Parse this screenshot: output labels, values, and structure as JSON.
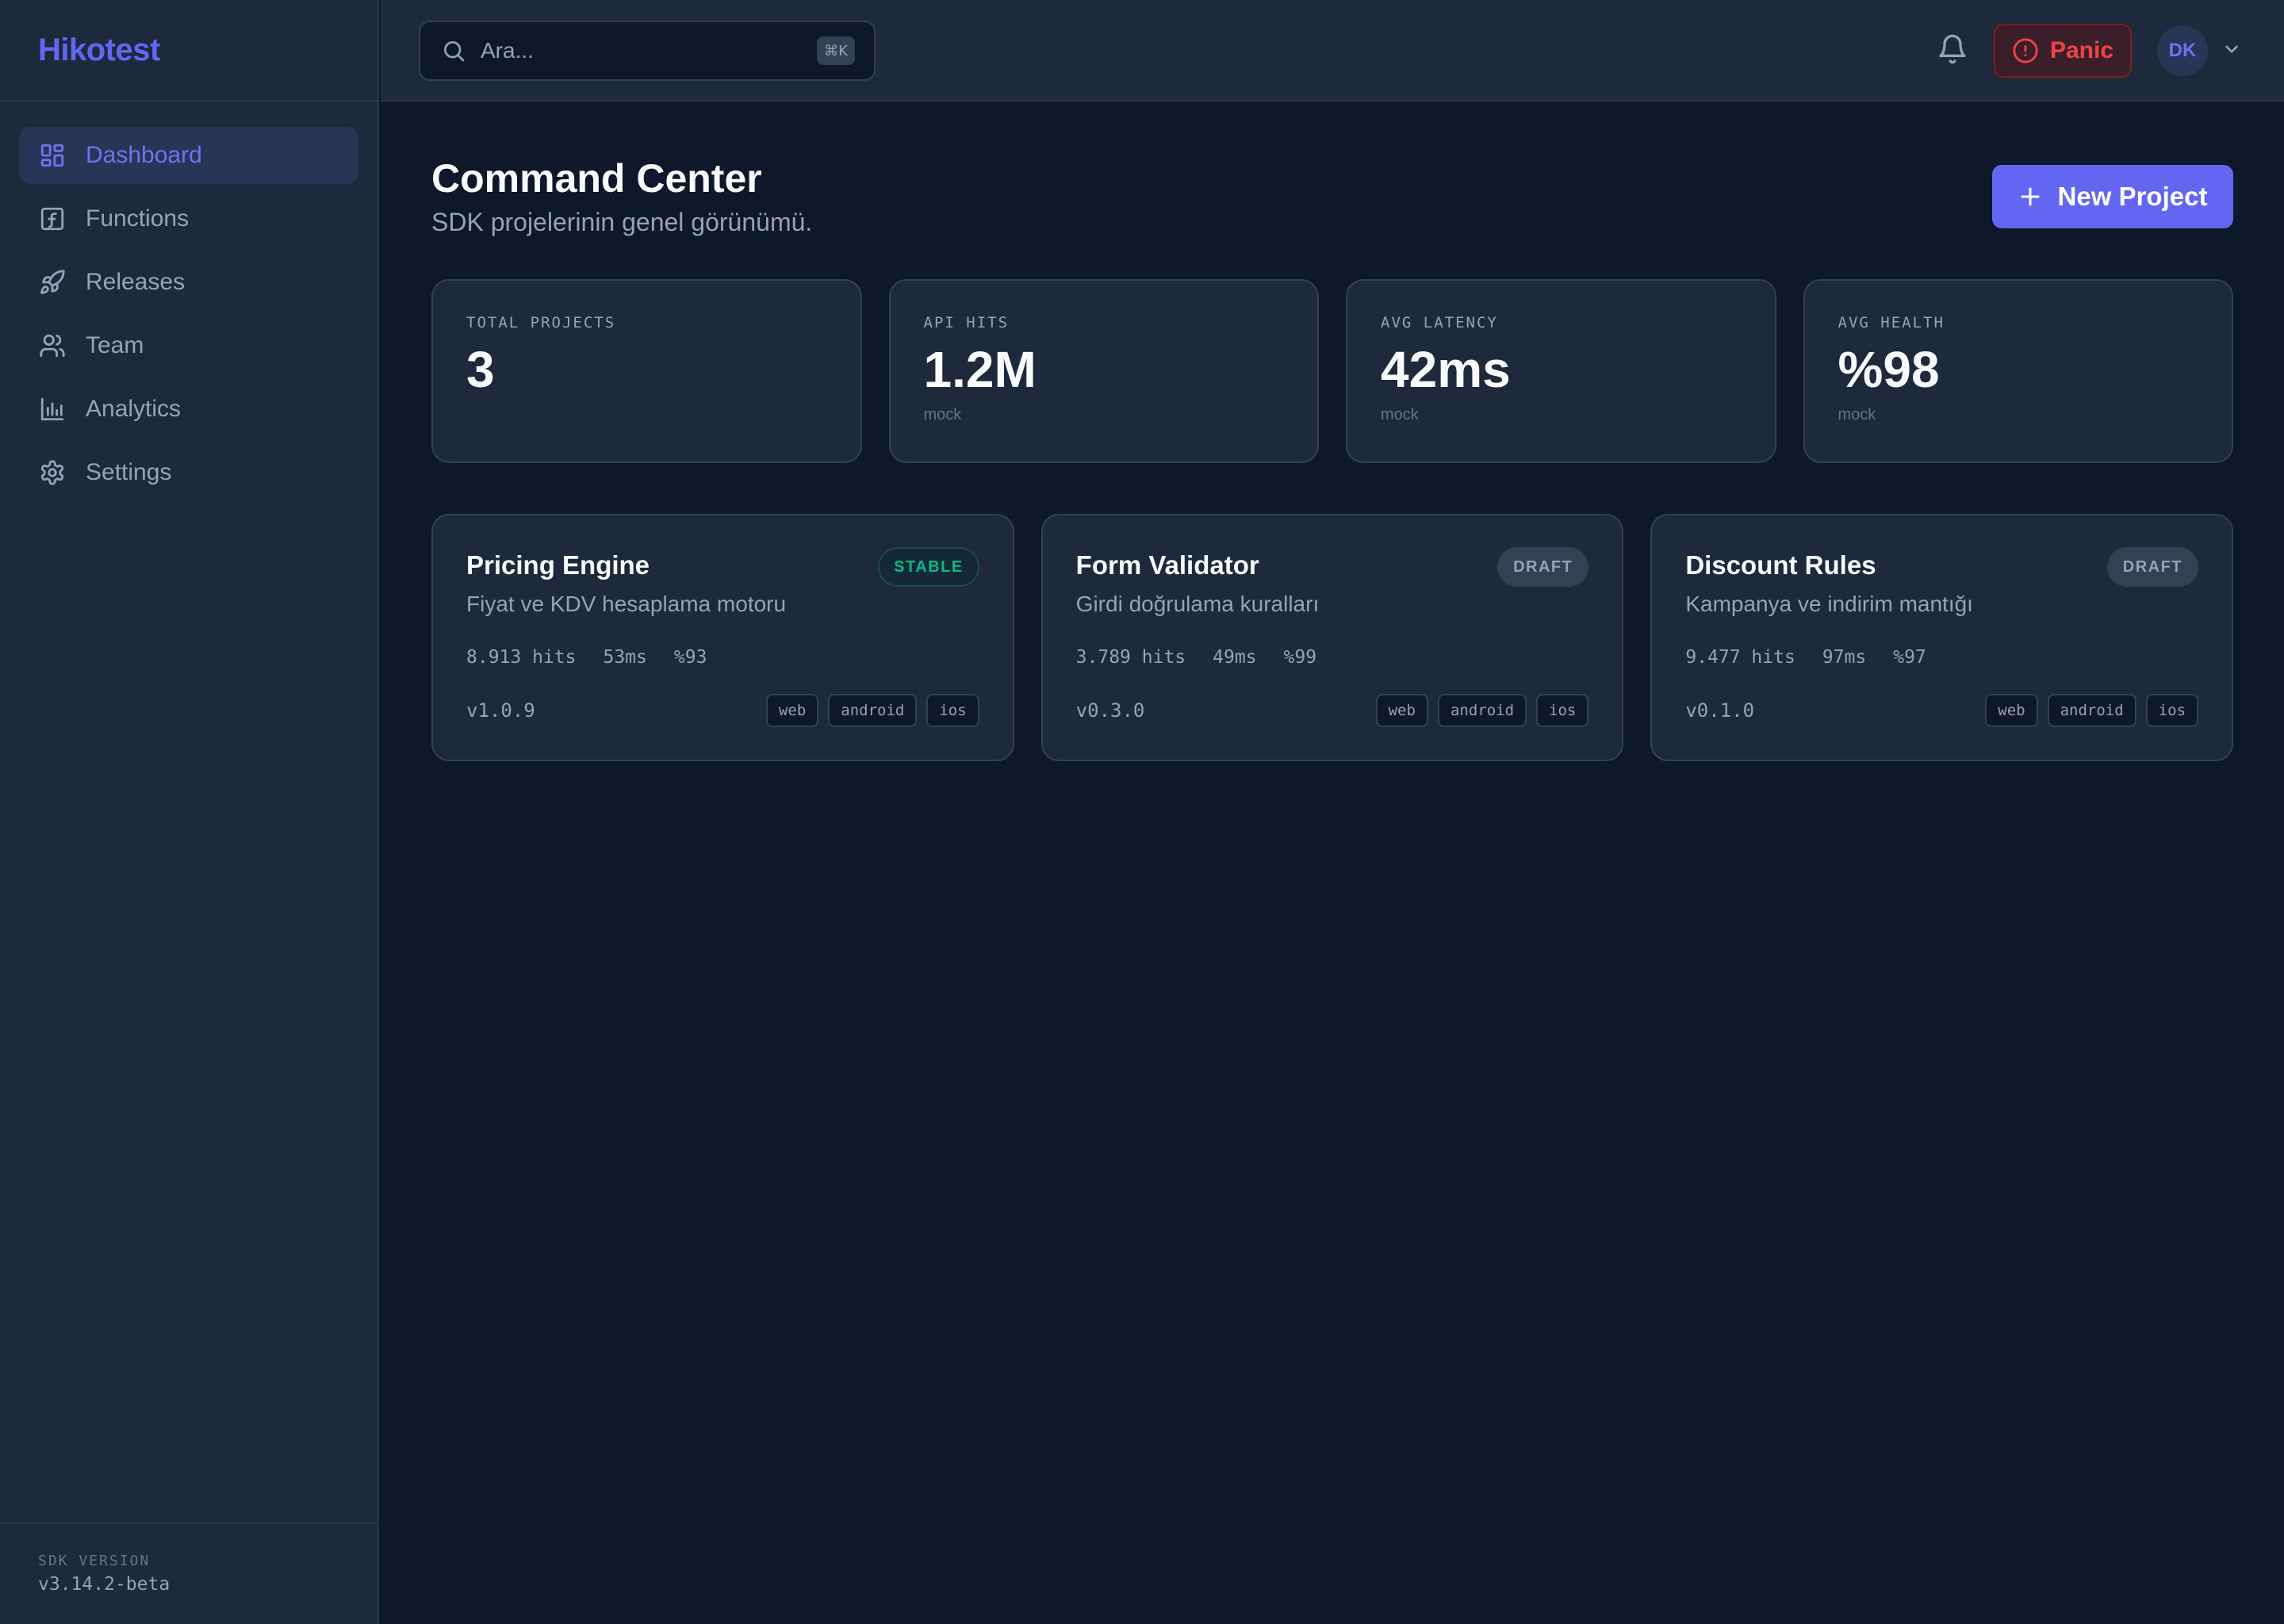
{
  "app": {
    "name": "Hikotest"
  },
  "theme": {
    "accent": "#6366f1",
    "background": "#0f172a",
    "panel": "#1e293b",
    "danger": "#ef4444",
    "success": "#10b981"
  },
  "sidebar": {
    "items": [
      {
        "label": "Dashboard",
        "icon": "dashboard-icon",
        "active": true
      },
      {
        "label": "Functions",
        "icon": "function-icon",
        "active": false
      },
      {
        "label": "Releases",
        "icon": "rocket-icon",
        "active": false
      },
      {
        "label": "Team",
        "icon": "users-icon",
        "active": false
      },
      {
        "label": "Analytics",
        "icon": "bar-chart-icon",
        "active": false
      },
      {
        "label": "Settings",
        "icon": "gear-icon",
        "active": false
      }
    ],
    "footer": {
      "label": "SDK VERSION",
      "version": "v3.14.2-beta"
    }
  },
  "header": {
    "search": {
      "placeholder": "Ara...",
      "value": "",
      "shortcut": "⌘K"
    },
    "panic_label": "Panic",
    "avatar_initials": "DK"
  },
  "main": {
    "title": "Command Center",
    "subtitle": "SDK projelerinin genel görünümü.",
    "new_project_label": "New Project",
    "stats": [
      {
        "label": "TOTAL PROJECTS",
        "value": "3",
        "sub": ""
      },
      {
        "label": "API HITS",
        "value": "1.2M",
        "sub": "mock"
      },
      {
        "label": "AVG LATENCY",
        "value": "42ms",
        "sub": "mock"
      },
      {
        "label": "AVG HEALTH",
        "value": "%98",
        "sub": "mock"
      }
    ],
    "projects": [
      {
        "name": "Pricing Engine",
        "description": "Fiyat ve KDV hesaplama motoru",
        "status": "STABLE",
        "hits": "8.913 hits",
        "latency": "53ms",
        "health": "%93",
        "version": "v1.0.9",
        "platforms": [
          "web",
          "android",
          "ios"
        ]
      },
      {
        "name": "Form Validator",
        "description": "Girdi doğrulama kuralları",
        "status": "DRAFT",
        "hits": "3.789 hits",
        "latency": "49ms",
        "health": "%99",
        "version": "v0.3.0",
        "platforms": [
          "web",
          "android",
          "ios"
        ]
      },
      {
        "name": "Discount Rules",
        "description": "Kampanya ve indirim mantığı",
        "status": "DRAFT",
        "hits": "9.477 hits",
        "latency": "97ms",
        "health": "%97",
        "version": "v0.1.0",
        "platforms": [
          "web",
          "android",
          "ios"
        ]
      }
    ]
  }
}
